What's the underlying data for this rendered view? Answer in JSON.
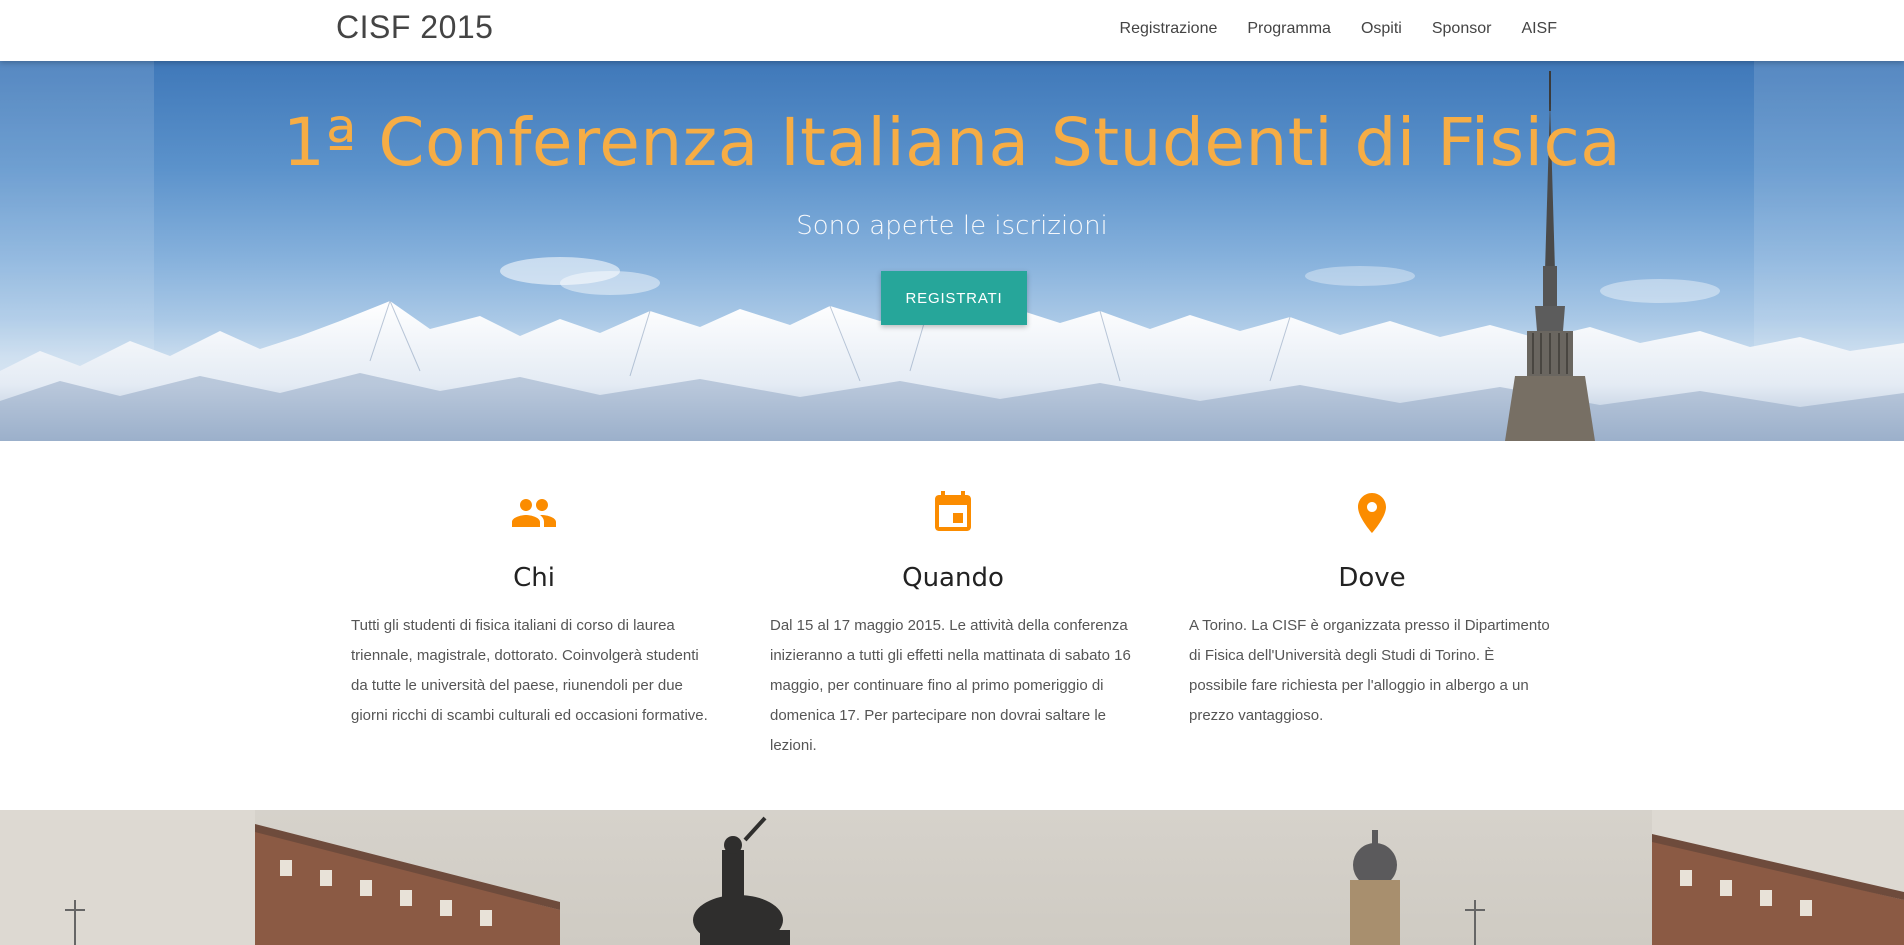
{
  "nav": {
    "brand": "CISF 2015",
    "links": [
      "Registrazione",
      "Programma",
      "Ospiti",
      "Sponsor",
      "AISF"
    ]
  },
  "hero": {
    "title": "1ª Conferenza Italiana Studenti di Fisica",
    "subtitle": "Sono aperte le iscrizioni",
    "button": "Registrati"
  },
  "features": [
    {
      "icon": "people-icon",
      "title": "Chi",
      "text": "Tutti gli studenti di fisica italiani di corso di laurea triennale, magistrale, dottorato. Coinvolgerà studenti da tutte le università del paese, riunendoli per due giorni ricchi di scambi culturali ed occasioni formative."
    },
    {
      "icon": "calendar-icon",
      "title": "Quando",
      "text": "Dal 15 al 17 maggio 2015. Le attività della conferenza inizieranno a tutti gli effetti nella mattinata di sabato 16 maggio, per continuare fino al primo pomeriggio di domenica 17. Per partecipare non dovrai saltare le lezioni."
    },
    {
      "icon": "location-pin-icon",
      "title": "Dove",
      "text": "A Torino. La CISF è organizzata presso il Dipartimento di Fisica dell'Università degli Studi di Torino. È possibile fare richiesta per l'alloggio in albergo a un prezzo vantaggioso."
    }
  ],
  "colors": {
    "accent": "#fb8c00",
    "title": "#f6ad45",
    "button": "#26a69a"
  }
}
